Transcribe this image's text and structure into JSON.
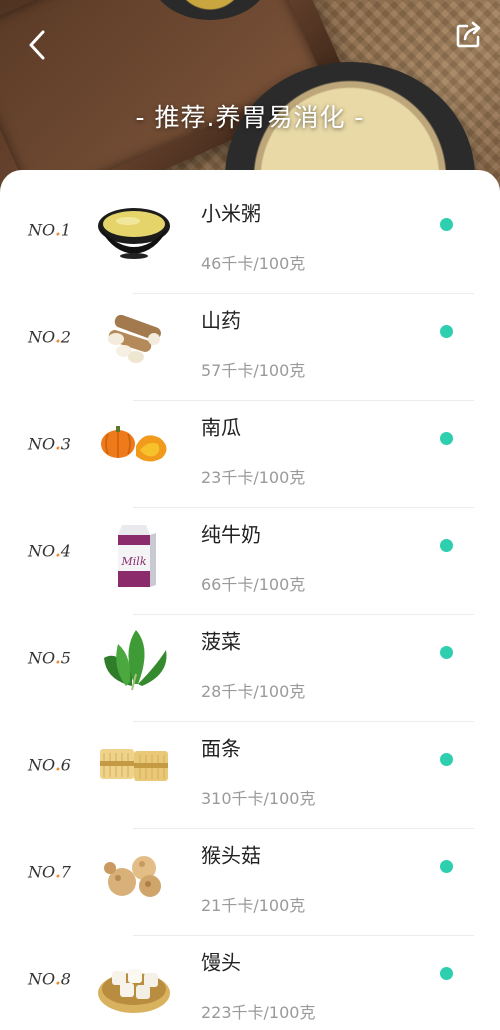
{
  "header": {
    "title": "- 推荐.养胃易消化 -",
    "back_icon": "chevron-left-icon",
    "share_icon": "share-export-icon"
  },
  "status_color": "#2ecfae",
  "rank_dot_color": "#f08a2c",
  "foods": [
    {
      "rank_prefix": "NO",
      "rank_num": "1",
      "name": "小米粥",
      "kcal": "46千卡/100克",
      "icon": "millet-porridge-image"
    },
    {
      "rank_prefix": "NO",
      "rank_num": "2",
      "name": "山药",
      "kcal": "57千卡/100克",
      "icon": "yam-image"
    },
    {
      "rank_prefix": "NO",
      "rank_num": "3",
      "name": "南瓜",
      "kcal": "23千卡/100克",
      "icon": "pumpkin-image"
    },
    {
      "rank_prefix": "NO",
      "rank_num": "4",
      "name": "纯牛奶",
      "kcal": "66千卡/100克",
      "icon": "milk-carton-image",
      "carton_text": "Milk"
    },
    {
      "rank_prefix": "NO",
      "rank_num": "5",
      "name": "菠菜",
      "kcal": "28千卡/100克",
      "icon": "spinach-image"
    },
    {
      "rank_prefix": "NO",
      "rank_num": "6",
      "name": "面条",
      "kcal": "310千卡/100克",
      "icon": "noodles-image"
    },
    {
      "rank_prefix": "NO",
      "rank_num": "7",
      "name": "猴头菇",
      "kcal": "21千卡/100克",
      "icon": "lions-mane-mushroom-image"
    },
    {
      "rank_prefix": "NO",
      "rank_num": "8",
      "name": "馒头",
      "kcal": "223千卡/100克",
      "icon": "steamed-bun-image"
    }
  ]
}
